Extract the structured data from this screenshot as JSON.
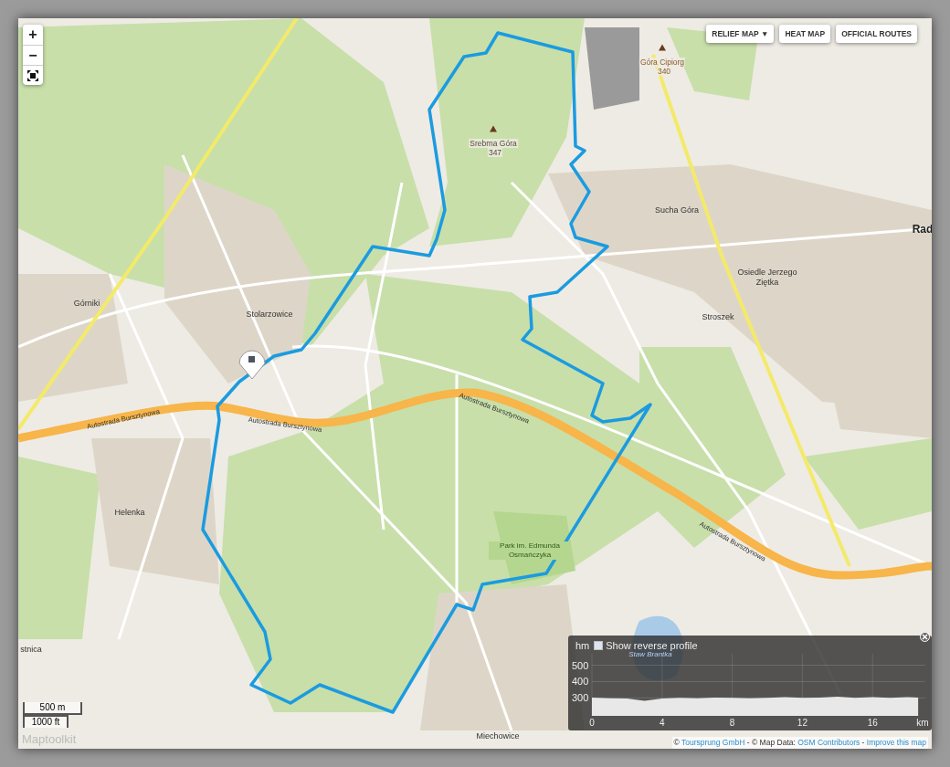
{
  "map_controls": [
    {
      "kind": "zoom_in",
      "label": "+"
    },
    {
      "kind": "zoom_out",
      "label": "−"
    },
    {
      "kind": "fullscreen"
    }
  ],
  "layer_buttons": [
    {
      "label": "RELIEF MAP",
      "caret": "▼"
    },
    {
      "label": "HEAT MAP"
    },
    {
      "label": "OFFICIAL ROUTES"
    }
  ],
  "peaks": [
    {
      "name": "Góra Cipiorg",
      "elevation": "340"
    },
    {
      "name": "Srebrna Góra",
      "elevation": "347"
    }
  ],
  "labels": [
    {
      "text": "Sucha Góra",
      "kind": "place"
    },
    {
      "text": "Rad",
      "kind": "city"
    },
    {
      "text": "Osiedle Jerzego Ziętka",
      "kind": "place"
    },
    {
      "text": "Stroszek",
      "kind": "place"
    },
    {
      "text": "Górniki",
      "kind": "place"
    },
    {
      "text": "Stolarzowice",
      "kind": "place"
    },
    {
      "text": "Helenka",
      "kind": "place"
    },
    {
      "text": "Park im. Edmunda Osmańczyka",
      "kind": "park"
    },
    {
      "text": "Miechowice",
      "kind": "place"
    },
    {
      "text": "stnica",
      "kind": "place"
    },
    {
      "text": "Autostrada Bursztynowa",
      "kind": "road"
    },
    {
      "text": "Autostrada Bursztynowa",
      "kind": "road"
    },
    {
      "text": "Autostrada Bursztynowa",
      "kind": "road"
    },
    {
      "text": "Autostrada Bursztynowa",
      "kind": "road"
    },
    {
      "text": "Staw Brantka",
      "kind": "water"
    }
  ],
  "scale": {
    "metric": "500 m",
    "imperial": "1000 ft"
  },
  "logo": "Maptoolkit",
  "profile": {
    "reverse_checkbox": {
      "label": "Show reverse profile",
      "checked": false
    },
    "chart_data": {
      "type": "area",
      "xlabel": "km",
      "ylabel": "hm",
      "xlim": [
        0,
        19
      ],
      "ylim": [
        190,
        570
      ],
      "grid": true,
      "xticks": [
        0,
        4,
        8,
        12,
        16
      ],
      "yticks": [
        300,
        400,
        500
      ],
      "x": [
        0,
        1,
        2,
        3,
        4,
        5,
        6,
        7,
        8,
        9,
        10,
        11,
        12,
        13,
        14,
        15,
        16,
        17,
        18,
        18.6
      ],
      "series": [
        {
          "color": "#e8e8e8",
          "values": [
            302,
            298,
            296,
            282,
            296,
            300,
            298,
            302,
            300,
            298,
            300,
            304,
            300,
            302,
            308,
            300,
            304,
            300,
            304,
            302
          ]
        }
      ]
    }
  },
  "attribution": [
    {
      "text": "© ",
      "kind": "plain"
    },
    {
      "text": "Toursprung GmbH",
      "kind": "link"
    },
    {
      "text": " - © Map Data: ",
      "kind": "plain"
    },
    {
      "text": "OSM Contributors",
      "kind": "link"
    },
    {
      "text": " - ",
      "kind": "plain"
    },
    {
      "text": "Improve this map",
      "kind": "link"
    }
  ]
}
